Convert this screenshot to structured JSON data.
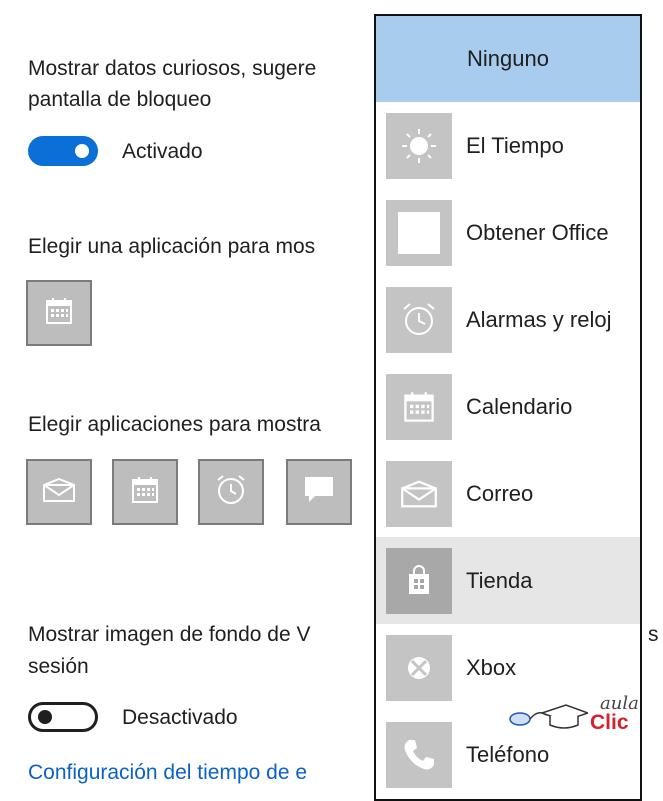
{
  "settings": {
    "fun_facts": {
      "label_line1": "Mostrar datos curiosos, sugere",
      "label_line2": "pantalla de bloqueo",
      "toggle_state": "Activado",
      "toggle_on": true
    },
    "detail_app": {
      "label": "Elegir una aplicación para mos",
      "app_icon": "calendar-icon"
    },
    "quick_status_apps": {
      "label": "Elegir aplicaciones para mostra",
      "apps": [
        "mail-icon",
        "calendar-icon",
        "alarm-clock-icon",
        "message-icon"
      ]
    },
    "background_signin": {
      "label_line1": "Mostrar imagen de fondo de V",
      "label_trailing": "s",
      "label_line2": "sesión",
      "toggle_state": "Desactivado",
      "toggle_on": false
    },
    "screen_timeout_link": "Configuración del tiempo de e"
  },
  "dropdown": {
    "header": "Ninguno",
    "items": [
      {
        "label": "El Tiempo",
        "icon": "sun-icon"
      },
      {
        "label": "Obtener Office",
        "icon": "office-icon"
      },
      {
        "label": "Alarmas y reloj",
        "icon": "alarm-clock-icon"
      },
      {
        "label": "Calendario",
        "icon": "calendar-icon"
      },
      {
        "label": "Correo",
        "icon": "mail-icon"
      },
      {
        "label": "Tienda",
        "icon": "store-icon",
        "selected": true
      },
      {
        "label": "Xbox",
        "icon": "xbox-icon"
      },
      {
        "label": "Teléfono",
        "icon": "phone-icon"
      }
    ]
  },
  "watermark": {
    "line1": "aula",
    "line2": "Clic"
  },
  "colors": {
    "accent": "#0a6fd6",
    "header_bg": "#a7ccee",
    "tile_bg": "#c4c4c4",
    "selected_bg": "#e6e6e6",
    "link": "#0a62c9"
  }
}
